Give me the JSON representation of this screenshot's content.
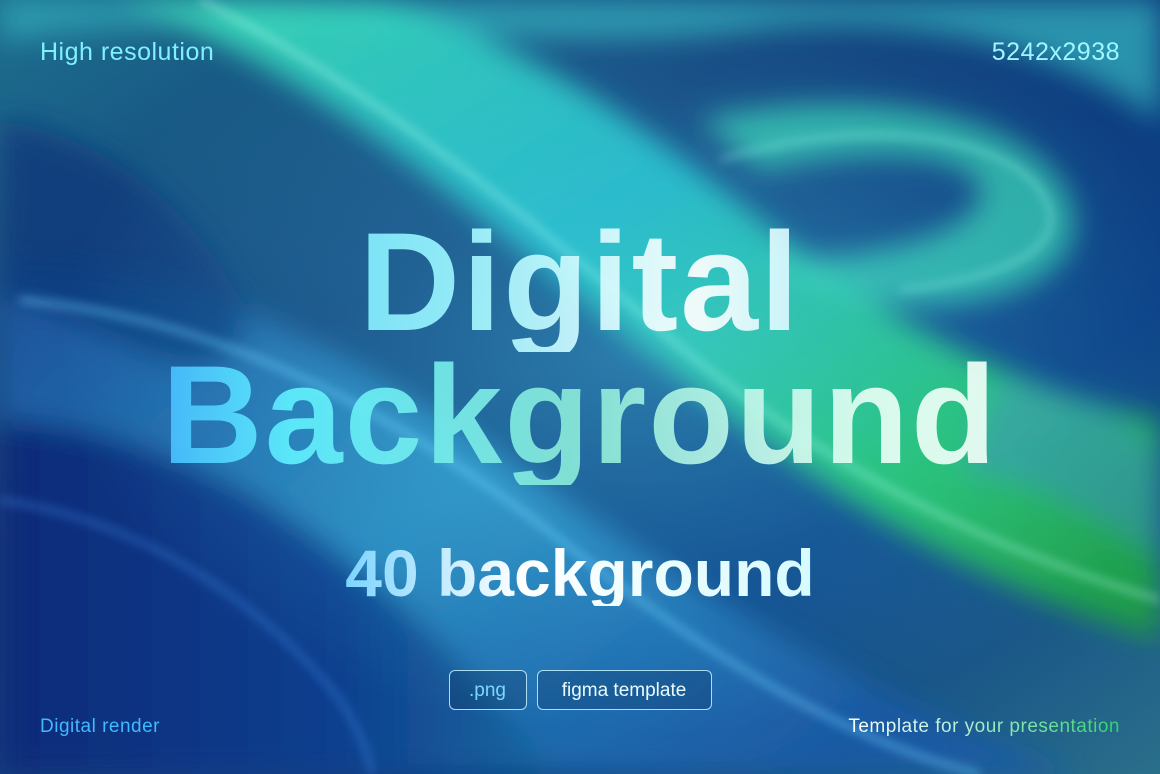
{
  "corners": {
    "top_left": "High resolution",
    "top_right": "5242x2938",
    "bottom_left": "Digital render",
    "bottom_right": "Template for your presentation"
  },
  "headline": {
    "line1": "Digital",
    "line2": "Background",
    "subline": "40 background"
  },
  "tags": [
    ".png",
    "figma template"
  ],
  "colors": {
    "deep_blue": "#062a66",
    "teal": "#1fb7c9",
    "green": "#2fcf58",
    "cyan_text": "#7ff0ff"
  }
}
